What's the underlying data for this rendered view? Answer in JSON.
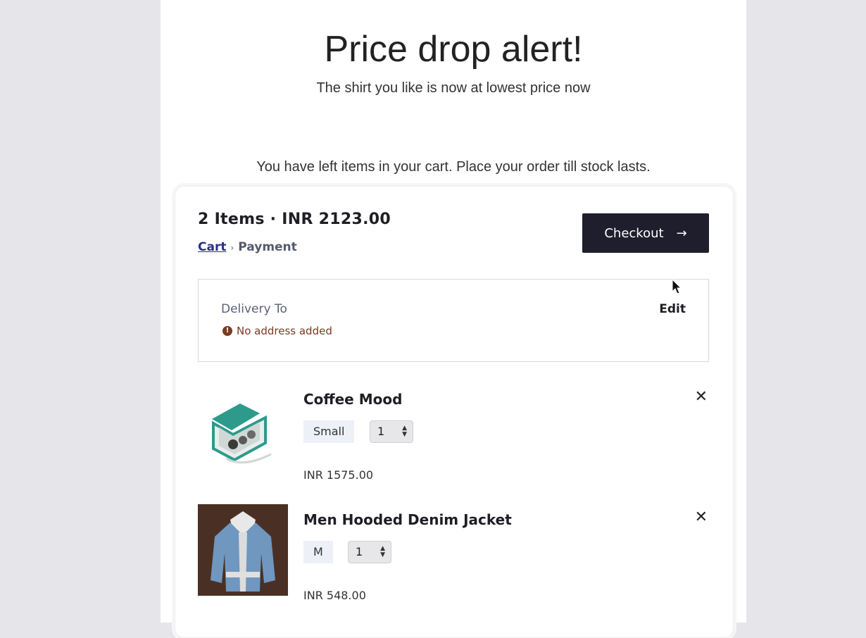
{
  "email": {
    "headline": "Price drop alert!",
    "subline": "The shirt you like is now at lowest price now",
    "reminder": "You have left items in your cart. Place your order till stock lasts."
  },
  "cart": {
    "summary": "2 Items · INR 2123.00",
    "breadcrumb": {
      "cart": "Cart",
      "separator": "›",
      "payment": "Payment"
    },
    "checkout_label": "Checkout",
    "checkout_arrow": "→"
  },
  "delivery": {
    "label": "Delivery To",
    "edit_label": "Edit",
    "warning_icon": "!",
    "warning": "No address added"
  },
  "items": [
    {
      "name": "Coffee Mood",
      "size": "Small",
      "qty": "1",
      "price": "INR 1575.00",
      "icon": "gift-box-image"
    },
    {
      "name": "Men Hooded Denim Jacket",
      "size": "M",
      "qty": "1",
      "price": "INR 548.00",
      "icon": "denim-jacket-image"
    }
  ],
  "remove_glyph": "✕",
  "stepper_glyph": "▲▼",
  "colors": {
    "checkout_bg": "#1e1e2c",
    "link": "#2a2e8a",
    "warning": "#7a3b22",
    "chip_bg": "#eef0f8"
  }
}
